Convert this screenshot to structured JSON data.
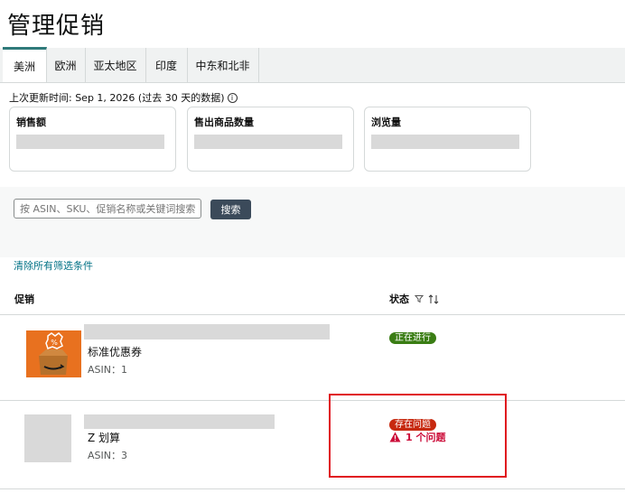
{
  "page": {
    "title": "管理促销"
  },
  "tabs": [
    {
      "label": "美洲",
      "active": true
    },
    {
      "label": "欧洲"
    },
    {
      "label": "亚太地区"
    },
    {
      "label": "印度"
    },
    {
      "label": "中东和北非"
    }
  ],
  "updated": {
    "text": "上次更新时间: Sep 1, 2026 (过去 30 天的数据)"
  },
  "metrics": [
    {
      "label": "销售额"
    },
    {
      "label": "售出商品数量"
    },
    {
      "label": "浏览量"
    }
  ],
  "search": {
    "placeholder": "按 ASIN、SKU、促销名称或关键词搜索",
    "button": "搜索"
  },
  "filters": {
    "clear_label": "清除所有筛选条件"
  },
  "table": {
    "headers": {
      "promotion": "促销",
      "status": "状态"
    },
    "rows": [
      {
        "name": "标准优惠券",
        "asin": "ASIN：1",
        "status": "正在进行"
      },
      {
        "name": "Z 划算",
        "asin": "ASIN：3",
        "status": "存在问题",
        "issue": "1 个问题"
      }
    ]
  },
  "colors": {
    "accent": "#2f7a7a",
    "status_ok": "#3a7d14",
    "status_error": "#c7290f",
    "issue_text": "#cc0c39",
    "highlight": "#e0141e"
  }
}
